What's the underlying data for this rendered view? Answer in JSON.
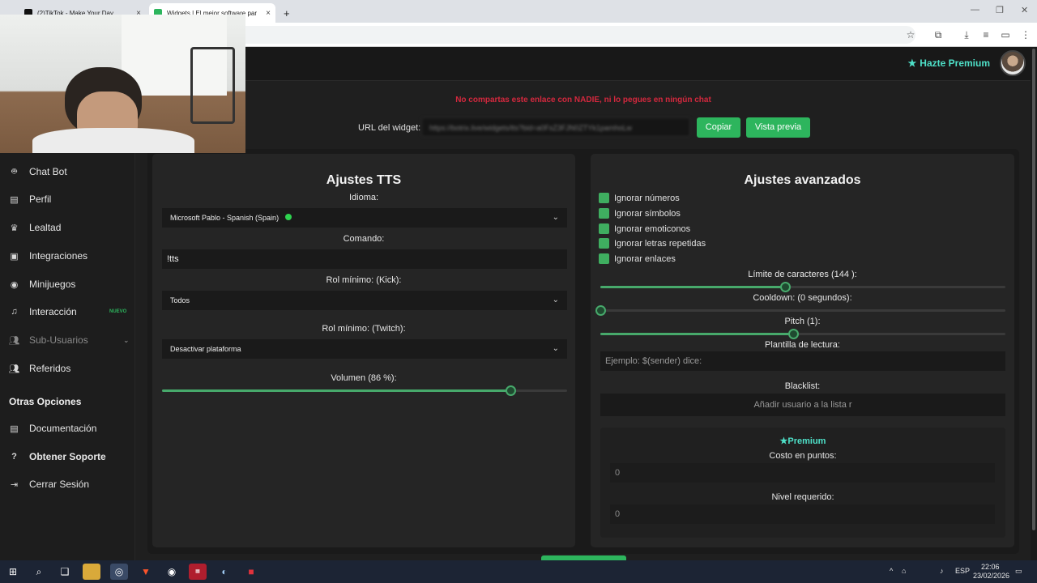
{
  "browser": {
    "tabs": [
      {
        "title": "(2)TikTok - Make Your Day",
        "color": "#111111"
      },
      {
        "title": "Widgets | El mejor software par",
        "color": "#2db55d"
      }
    ],
    "new_tab_symbol": "+",
    "close_symbol": "×",
    "toolbar_icons": [
      "star-icon",
      "extensions-icon",
      "download-icon",
      "media-icon",
      "profile-icon",
      "menu-icon"
    ]
  },
  "header": {
    "premium_label": "Hazte Premium",
    "accent": "#4ee0c8"
  },
  "widget": {
    "warning": "No compartas este enlace con NADIE, ni lo pegues en ningún chat",
    "url_label": "URL del widget:",
    "url_value": "https://botrix.live/widgets/tts?bid=a0FsZ3FJN0ZTYk1pamhoLw",
    "copy_label": "Copiar",
    "preview_label": "Vista previa",
    "button_color": "#2db55d",
    "warning_color": "#d4283e"
  },
  "sidebar": {
    "items": [
      {
        "label": "Chat Bot",
        "icon": "robot-icon"
      },
      {
        "label": "Perfil",
        "icon": "id-card-icon"
      },
      {
        "label": "Lealtad",
        "icon": "trophy-icon"
      },
      {
        "label": "Integraciones",
        "icon": "plug-icon"
      },
      {
        "label": "Minijuegos",
        "icon": "gamepad-icon"
      },
      {
        "label": "Interacción",
        "icon": "music-icon",
        "badge": "NUEVO"
      },
      {
        "label": "Sub-Usuarios",
        "icon": "users-icon"
      },
      {
        "label": "Referidos",
        "icon": "user-group-icon"
      }
    ],
    "other_heading": "Otras Opciones",
    "other_items": [
      {
        "label": "Documentación",
        "icon": "book-icon"
      },
      {
        "label": "Obtener Soporte",
        "icon": "question-icon"
      },
      {
        "label": "Cerrar Sesión",
        "icon": "logout-icon"
      }
    ]
  },
  "tts": {
    "title": "Ajustes TTS",
    "language_label": "Idioma:",
    "language_value": "Microsoft Pablo - Spanish (Spain)",
    "command_label": "Comando:",
    "command_value": "!tts",
    "kick_role_label": "Rol mínimo: (Kick):",
    "kick_role_value": "Todos",
    "twitch_role_label": "Rol mínimo: (Twitch):",
    "twitch_role_value": "Desactivar plataforma",
    "volume_label": "Volumen (86 %):",
    "volume": 0.86
  },
  "advanced": {
    "title": "Ajustes avanzados",
    "options": [
      {
        "label": "Ignorar números",
        "checked": true
      },
      {
        "label": "Ignorar símbolos",
        "checked": true
      },
      {
        "label": "Ignorar emoticonos",
        "checked": true
      },
      {
        "label": "Ignorar letras repetidas",
        "checked": true
      },
      {
        "label": "Ignorar enlaces",
        "checked": true
      }
    ],
    "char_limit_label": "Límite de caracteres (144 ):",
    "char_limit_fraction": 0.455,
    "cooldown_label": "Cooldown: (0 segundos):",
    "cooldown_fraction": 0,
    "pitch_label": "Pitch (1):",
    "pitch_fraction": 0.475,
    "template_label": "Plantilla de lectura:",
    "template_placeholder": "Ejemplo: $(sender) dice:",
    "blacklist_label": "Blacklist:",
    "blacklist_placeholder": "Añadir usuario a la lista r",
    "premium_heading": "Premium",
    "cost_label": "Costo en puntos:",
    "cost_value": "0",
    "level_label": "Nivel requerido:",
    "level_value": "0"
  },
  "taskbar": {
    "language": "ESP",
    "time": "22:06",
    "date": "23/02/2026"
  }
}
